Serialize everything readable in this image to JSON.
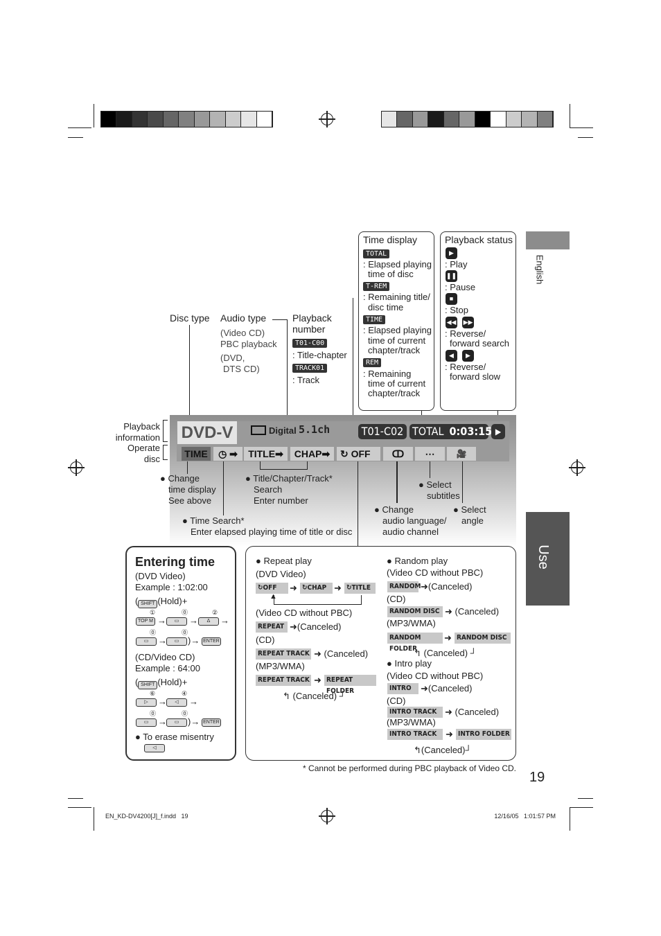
{
  "registration": {
    "left_colors": [
      "#000",
      "#1a1a1a",
      "#333",
      "#4a4a4a",
      "#666",
      "#808080",
      "#999",
      "#b3b3b3",
      "#ccc",
      "#e6e6e6",
      "#fff"
    ],
    "right_colors": [
      "#e6e6e6",
      "#666",
      "#999",
      "#1a1a1a",
      "#666",
      "#999",
      "#000",
      "#fff",
      "#ccc",
      "#b3b3b3",
      "#808080"
    ]
  },
  "side_tabs": {
    "english": "English",
    "use": "Use",
    "english_color": "#8c8c8c",
    "use_color": "#555555"
  },
  "time_display": {
    "title": "Time display",
    "items": [
      {
        "badge": "TOTAL",
        "text": [
          ": Elapsed playing",
          "time of disc"
        ]
      },
      {
        "badge": "T-REM",
        "text": [
          ": Remaining title/",
          "disc time"
        ]
      },
      {
        "badge": "TIME",
        "text": [
          ": Elapsed playing",
          "time of current",
          "chapter/track"
        ]
      },
      {
        "badge": "REM",
        "text": [
          ": Remaining",
          "time of current",
          "chapter/track"
        ]
      }
    ]
  },
  "playback_status": {
    "title": "Playback status",
    "items": [
      {
        "icons": [
          "play-icon"
        ],
        "text": [
          ": Play"
        ]
      },
      {
        "icons": [
          "pause-icon"
        ],
        "text": [
          ": Pause"
        ]
      },
      {
        "icons": [
          "stop-icon"
        ],
        "text": [
          ": Stop"
        ]
      },
      {
        "icons": [
          "reverse-search-icon",
          "forward-search-icon"
        ],
        "text": [
          ": Reverse/",
          "forward search"
        ]
      },
      {
        "icons": [
          "reverse-slow-icon",
          "forward-slow-icon"
        ],
        "text": [
          ": Reverse/",
          "forward slow"
        ]
      }
    ]
  },
  "labels": {
    "disc_type": "Disc type",
    "audio_type": "Audio type",
    "audio_lines": [
      "(Video CD)",
      "PBC playback",
      "(DVD,",
      "DTS CD)"
    ],
    "playback_number": [
      "Playback",
      "number"
    ],
    "pn_badge1": "T01-C00",
    "pn_text1": ": Title-chapter",
    "pn_badge2": "TRACK01",
    "pn_text2": ": Track",
    "playback_information": [
      "Playback",
      "information"
    ],
    "operate_disc": [
      "Operate",
      "disc"
    ]
  },
  "display": {
    "disc": "DVD-V",
    "audio_logo": "Digital",
    "channels": "5.1ch",
    "number": "T01-C02",
    "time_mode": "TOTAL",
    "time": "0:03:15",
    "status": "▶",
    "buttons": [
      "TIME",
      "◷ ➡",
      "TITLE➡",
      "CHAP➡",
      "↻ OFF",
      "ↀ",
      "⋯",
      "🎥"
    ]
  },
  "annotations": {
    "change_time": [
      "Change",
      "time display",
      "See above"
    ],
    "title_search": [
      "Title/Chapter/Track*",
      "Search",
      "Enter number"
    ],
    "time_search": [
      "Time Search*",
      "Enter elapsed playing time of title or disc"
    ],
    "subtitles": [
      "Select",
      "subtitles"
    ],
    "audio": [
      "Change",
      "audio language/",
      "audio channel"
    ],
    "angle": [
      "Select",
      "angle"
    ]
  },
  "entering_time": {
    "title": "Entering time",
    "dvd": "(DVD Video)",
    "dvd_example": "Example : 1:02:00",
    "shift": "SHIFT",
    "hold": "(Hold)+",
    "topm": "TOP M",
    "enter": "ENTER",
    "cd": "(CD/Video CD)",
    "cd_example": "Example : 64:00",
    "erase": "To erase misentry",
    "nums1": [
      "①",
      "⓪",
      "②",
      "⓪",
      "⓪"
    ],
    "nums2": [
      "⑥",
      "④",
      "⓪",
      "⓪"
    ]
  },
  "repeat": {
    "title": "Repeat play",
    "dvd": "(DVD Video)",
    "dvd_chips": [
      "↻OFF",
      "↻CHAP",
      "↻TITLE"
    ],
    "vcd": "(Video CD without PBC)",
    "vcd_chip": "REPEAT",
    "cd": "(CD)",
    "cd_chip": "REPEAT TRACK",
    "mp3": "(MP3/WMA)",
    "mp3_chips": [
      "REPEAT TRACK",
      "REPEAT FOLDER"
    ],
    "canceled": "(Canceled)"
  },
  "random": {
    "title": "Random play",
    "vcd": "(Video CD without PBC)",
    "vcd_chip": "RANDOM",
    "cd": "(CD)",
    "cd_chip": "RANDOM DISC",
    "mp3": "(MP3/WMA)",
    "mp3_chips": [
      "RANDOM FOLDER",
      "RANDOM DISC"
    ],
    "canceled": "(Canceled)"
  },
  "intro": {
    "title": "Intro play",
    "vcd": "(Video CD without PBC)",
    "vcd_chip": "INTRO",
    "cd": "(CD)",
    "cd_chip": "INTRO TRACK",
    "mp3": "(MP3/WMA)",
    "mp3_chips": [
      "INTRO TRACK",
      "INTRO FOLDER"
    ],
    "canceled": "(Canceled)"
  },
  "footnote": "* Cannot be performed during PBC playback of Video CD.",
  "page_number": "19",
  "footer": {
    "file": "EN_KD-DV4200[J]_f.indd   19",
    "date": "12/16/05   1:01:57 PM"
  }
}
